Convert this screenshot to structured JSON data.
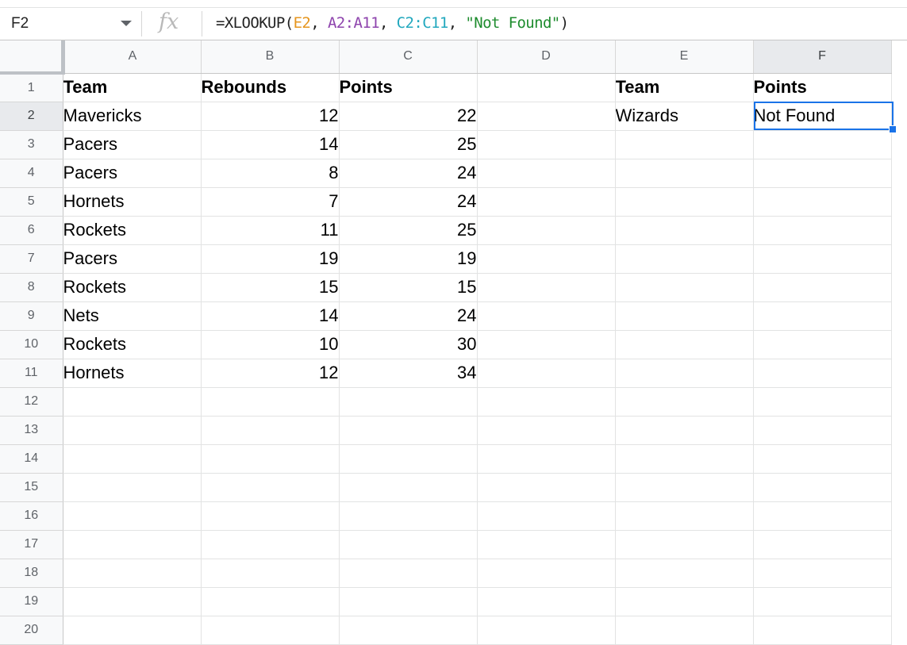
{
  "formula_bar": {
    "cell_ref": "F2",
    "fx_label": "fx",
    "formula_parts": [
      {
        "text": "=XLOOKUP(",
        "cls": ""
      },
      {
        "text": "E2",
        "cls": "tok-e"
      },
      {
        "text": ", ",
        "cls": ""
      },
      {
        "text": "A2:A11",
        "cls": "tok-a"
      },
      {
        "text": ", ",
        "cls": ""
      },
      {
        "text": "C2:C11",
        "cls": "tok-c"
      },
      {
        "text": ", ",
        "cls": ""
      },
      {
        "text": "\"Not Found\"",
        "cls": "tok-s"
      },
      {
        "text": ")",
        "cls": ""
      }
    ]
  },
  "columns": [
    "A",
    "B",
    "C",
    "D",
    "E",
    "F"
  ],
  "active_column": "F",
  "active_row": "2",
  "rows": [
    {
      "num": "1",
      "cells": [
        "Team",
        "Rebounds",
        "Points",
        "",
        "Team",
        "Points"
      ]
    },
    {
      "num": "2",
      "cells": [
        "Mavericks",
        "12",
        "22",
        "",
        "Wizards",
        "Not Found"
      ]
    },
    {
      "num": "3",
      "cells": [
        "Pacers",
        "14",
        "25",
        "",
        "",
        ""
      ]
    },
    {
      "num": "4",
      "cells": [
        "Pacers",
        "8",
        "24",
        "",
        "",
        ""
      ]
    },
    {
      "num": "5",
      "cells": [
        "Hornets",
        "7",
        "24",
        "",
        "",
        ""
      ]
    },
    {
      "num": "6",
      "cells": [
        "Rockets",
        "11",
        "25",
        "",
        "",
        ""
      ]
    },
    {
      "num": "7",
      "cells": [
        "Pacers",
        "19",
        "19",
        "",
        "",
        ""
      ]
    },
    {
      "num": "8",
      "cells": [
        "Rockets",
        "15",
        "15",
        "",
        "",
        ""
      ]
    },
    {
      "num": "9",
      "cells": [
        "Nets",
        "14",
        "24",
        "",
        "",
        ""
      ]
    },
    {
      "num": "10",
      "cells": [
        "Rockets",
        "10",
        "30",
        "",
        "",
        ""
      ]
    },
    {
      "num": "11",
      "cells": [
        "Hornets",
        "12",
        "34",
        "",
        "",
        ""
      ]
    },
    {
      "num": "12",
      "cells": [
        "",
        "",
        "",
        "",
        "",
        ""
      ]
    },
    {
      "num": "13",
      "cells": [
        "",
        "",
        "",
        "",
        "",
        ""
      ]
    },
    {
      "num": "14",
      "cells": [
        "",
        "",
        "",
        "",
        "",
        ""
      ]
    },
    {
      "num": "15",
      "cells": [
        "",
        "",
        "",
        "",
        "",
        ""
      ]
    },
    {
      "num": "16",
      "cells": [
        "",
        "",
        "",
        "",
        "",
        ""
      ]
    },
    {
      "num": "17",
      "cells": [
        "",
        "",
        "",
        "",
        "",
        ""
      ]
    },
    {
      "num": "18",
      "cells": [
        "",
        "",
        "",
        "",
        "",
        ""
      ]
    },
    {
      "num": "19",
      "cells": [
        "",
        "",
        "",
        "",
        "",
        ""
      ]
    },
    {
      "num": "20",
      "cells": [
        "",
        "",
        "",
        "",
        "",
        ""
      ]
    }
  ]
}
